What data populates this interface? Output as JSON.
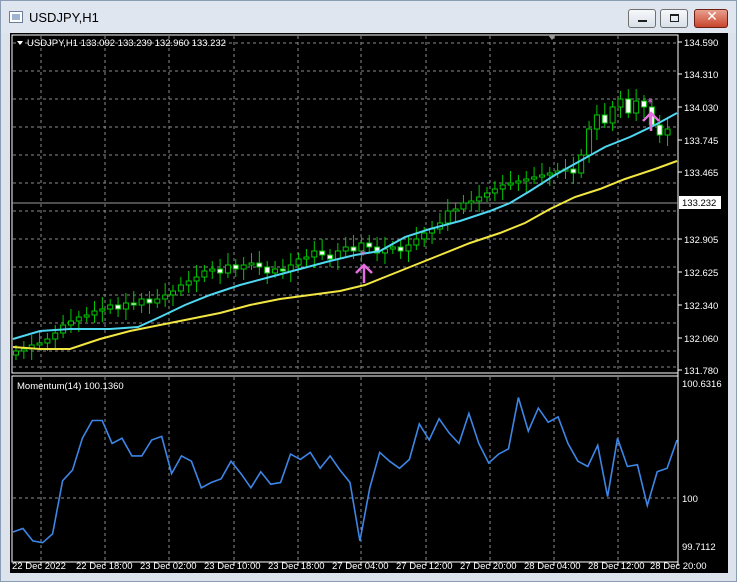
{
  "window": {
    "title": "USDJPY,H1",
    "minimize_label": "",
    "maximize_label": "",
    "close_label": "✕"
  },
  "chart": {
    "header": "USDJPY,H1  133.092 133.239 132.960 133.232",
    "current_price": "133.232",
    "price_ticks": [
      "134.590",
      "134.310",
      "134.030",
      "133.745",
      "133.465",
      "133.185",
      "132.905",
      "132.625",
      "132.340",
      "132.060",
      "131.780"
    ],
    "time_ticks": [
      "22 Dec 2022",
      "22 Dec 18:00",
      "23 Dec 02:00",
      "23 Dec 10:00",
      "23 Dec 18:00",
      "27 Dec 04:00",
      "27 Dec 12:00",
      "27 Dec 20:00",
      "28 Dec 04:00",
      "28 Dec 12:00",
      "28 Dec 20:00"
    ],
    "indicator_header": "Momentum(14) 100.1360",
    "indicator_ticks": [
      "100.6316",
      "100",
      "99.7112"
    ]
  },
  "colors": {
    "background": "#000000",
    "grid": "#8c8c8c",
    "bull_candle": "#000000",
    "bear_candle": "#ffffff",
    "wick": "#00c800",
    "ma_fast": "#4fd8f0",
    "ma_slow": "#f2e642",
    "momentum": "#3d86e6",
    "signal_arrow": "#e56fe0"
  },
  "chart_data": {
    "type": "line",
    "series": [
      {
        "name": "Momentum(14)",
        "values": [
          99.79,
          99.81,
          99.74,
          99.73,
          99.78,
          100.08,
          100.14,
          100.32,
          100.42,
          100.42,
          100.29,
          100.32,
          100.22,
          100.22,
          100.31,
          100.33,
          100.12,
          100.22,
          100.19,
          100.04,
          100.07,
          100.09,
          100.19,
          100.12,
          100.04,
          100.13,
          100.06,
          100.07,
          100.23,
          100.2,
          100.24,
          100.15,
          100.22,
          100.14,
          100.07,
          99.74,
          100.04,
          100.24,
          100.19,
          100.15,
          100.2,
          100.4,
          100.31,
          100.43,
          100.35,
          100.29,
          100.46,
          100.29,
          100.18,
          100.23,
          100.26,
          100.55,
          100.36,
          100.49,
          100.41,
          100.44,
          100.29,
          100.19,
          100.16,
          100.28,
          99.99,
          100.32,
          100.16,
          100.17,
          99.94,
          100.13,
          100.15,
          100.31
        ]
      }
    ],
    "ylim": [
      99.7112,
      100.6316
    ]
  }
}
